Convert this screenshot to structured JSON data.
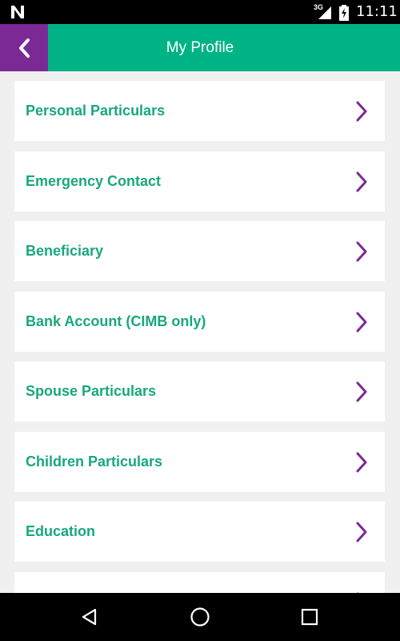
{
  "status_bar": {
    "network": "3G",
    "time": "11:11"
  },
  "app_bar": {
    "title": "My Profile"
  },
  "menu_items": [
    {
      "label": "Personal Particulars"
    },
    {
      "label": "Emergency Contact"
    },
    {
      "label": "Beneficiary"
    },
    {
      "label": "Bank Account (CIMB only)"
    },
    {
      "label": "Spouse Particulars"
    },
    {
      "label": "Children Particulars"
    },
    {
      "label": "Education"
    },
    {
      "label": ""
    }
  ],
  "colors": {
    "primary": "#00b386",
    "accent": "#7b2a95",
    "item_text": "#17a87e",
    "background": "#f0f0f0"
  },
  "icons": {
    "back": "chevron-left-icon",
    "item": "chevron-right-icon",
    "nav_back": "triangle-back-icon",
    "nav_home": "circle-home-icon",
    "nav_recent": "square-recent-icon"
  }
}
